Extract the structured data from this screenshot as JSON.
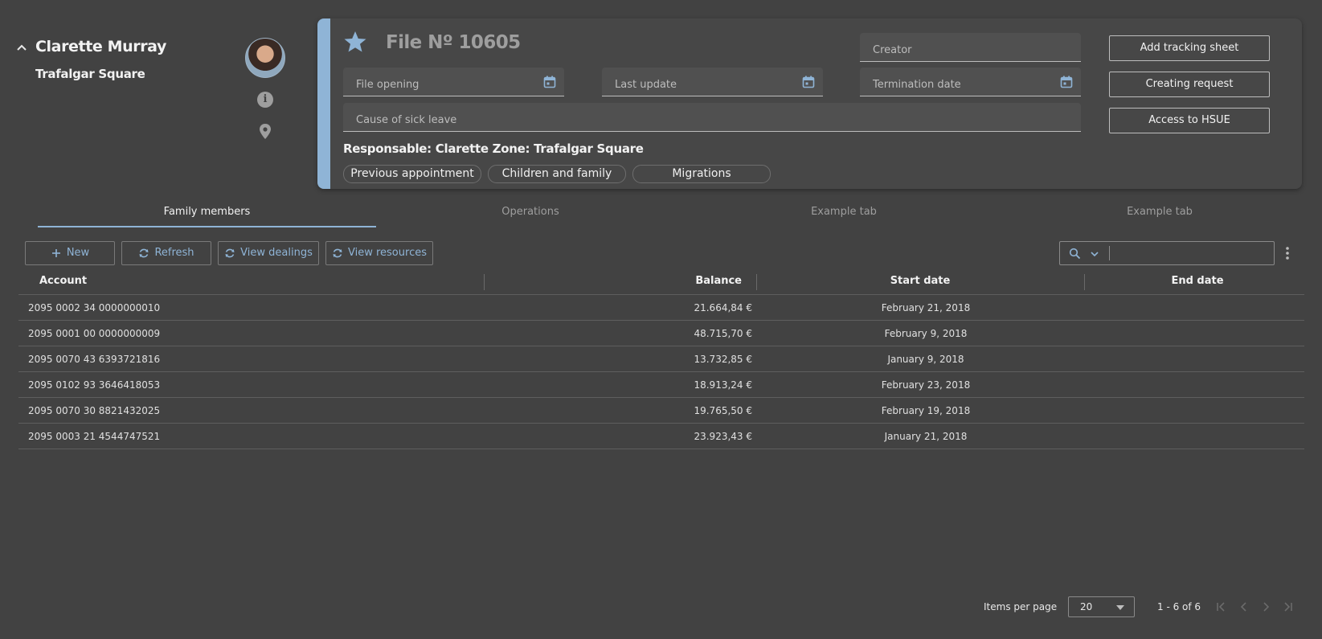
{
  "person": {
    "name": "Clarette Murray",
    "zone": "Trafalgar Square",
    "info_glyph": "i"
  },
  "file": {
    "title": "File Nº 10605",
    "fields": {
      "creator": "Creator",
      "file_opening": "File opening",
      "last_update": "Last update",
      "termination_date": "Termination date",
      "cause": "Cause of sick leave"
    },
    "meta": "Responsable: Clarette  Zone: Trafalgar Square",
    "chips": [
      "Previous appointment",
      "Children and family",
      "Migrations"
    ],
    "actions": [
      "Add tracking sheet",
      "Creating request",
      "Access to HSUE"
    ],
    "accent_color": "#8fb4d6"
  },
  "tabs": [
    "Family members",
    "Operations",
    "Example tab",
    "Example tab"
  ],
  "toolbar": {
    "new_label": "New",
    "refresh_label": "Refresh",
    "view_dealings_label": "View dealings",
    "view_resources_label": "View resources",
    "search_value": ""
  },
  "table": {
    "columns": [
      "Account",
      "Balance",
      "Start date",
      "End date"
    ],
    "rows": [
      {
        "account": "2095 0002 34 0000000010",
        "balance": "21.664,84 €",
        "start": "February 21, 2018",
        "end": ""
      },
      {
        "account": "2095 0001 00 0000000009",
        "balance": "48.715,70 €",
        "start": "February 9, 2018",
        "end": ""
      },
      {
        "account": "2095 0070 43 6393721816",
        "balance": "13.732,85 €",
        "start": "January 9, 2018",
        "end": ""
      },
      {
        "account": "2095 0102 93 3646418053",
        "balance": "18.913,24 €",
        "start": "February 23, 2018",
        "end": ""
      },
      {
        "account": "2095 0070 30 8821432025",
        "balance": "19.765,50 €",
        "start": "February 19, 2018",
        "end": ""
      },
      {
        "account": "2095 0003 21 4544747521",
        "balance": "23.923,43 €",
        "start": "January 21, 2018",
        "end": ""
      }
    ]
  },
  "pagination": {
    "items_per_page_label": "Items per page",
    "items_per_page_value": "20",
    "range": "1 - 6 of 6"
  }
}
